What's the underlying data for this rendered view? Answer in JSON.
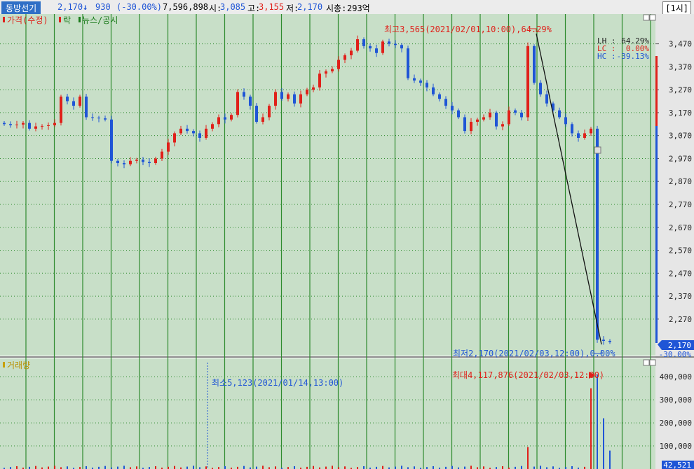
{
  "header": {
    "symbol": "동방선기",
    "price": "2,170",
    "change_arrow": "↓",
    "change": "930",
    "change_pct": "(-30.00%)",
    "volume": "7,596,898",
    "open_label": "시:",
    "open": "3,085",
    "high_label": "고:",
    "high": "3,155",
    "low_label": "저:",
    "low": "2,170",
    "mcap_label": "시총:",
    "mcap": "293억",
    "interval": "[1시]"
  },
  "legend": {
    "price": "가격(수정)",
    "rak": "락",
    "news": "뉴스/공시",
    "volume": "거래량"
  },
  "annotations": {
    "high": "최고3,565(2021/02/01,10:00),64.29%",
    "low": "최저2,170(2021/02/03,12:00),0.00%",
    "vol_max": "최대4,117,876(2021/02/03,12:00)",
    "vol_min": "최소5,123(2021/01/14,13:00)"
  },
  "lh": {
    "lh_label": "LH :",
    "lh": "64.29%",
    "lc_label": "LC :",
    "lc": "0.00%",
    "hc_label": "HC :",
    "hc": "-39.13%"
  },
  "current": {
    "price": "2,170",
    "pct": "-30.00%"
  },
  "colors": {
    "up": "#e0201a",
    "down": "#1f55d6",
    "bg": "#c8dfc8",
    "grid": "#2e8b2e"
  },
  "chart_data": {
    "type": "candlestick",
    "ylim": [
      2120,
      3600
    ],
    "y_ticks": [
      "3,470",
      "3,370",
      "3,270",
      "3,170",
      "3,070",
      "2,970",
      "2,870",
      "2,770",
      "2,670",
      "2,570",
      "2,470",
      "2,370",
      "2,270"
    ],
    "y_tick_values": [
      3470,
      3370,
      3270,
      3170,
      3070,
      2970,
      2870,
      2770,
      2670,
      2570,
      2470,
      2370,
      2270
    ],
    "volume_ylim": [
      0,
      440000
    ],
    "volume_ticks": [
      "400,000",
      "300,000",
      "200,000",
      "100,000"
    ],
    "volume_tick_values": [
      400000,
      300000,
      200000,
      100000
    ],
    "volume_last": "42,521",
    "close": [
      3120,
      3115,
      3118,
      3125,
      3100,
      3110,
      3112,
      3115,
      3125,
      3240,
      3220,
      3200,
      3240,
      3150,
      3148,
      3145,
      3140,
      2960,
      2950,
      2945,
      2960,
      2965,
      2955,
      2950,
      2970,
      3000,
      3040,
      3080,
      3100,
      3090,
      3080,
      3060,
      3100,
      3120,
      3150,
      3140,
      3160,
      3260,
      3240,
      3200,
      3130,
      3150,
      3200,
      3260,
      3230,
      3250,
      3210,
      3250,
      3270,
      3280,
      3340,
      3350,
      3360,
      3400,
      3420,
      3440,
      3490,
      3460,
      3450,
      3430,
      3480,
      3470,
      3465,
      3450,
      3320,
      3310,
      3300,
      3280,
      3250,
      3230,
      3200,
      3180,
      3150,
      3090,
      3130,
      3140,
      3150,
      3170,
      3110,
      3120,
      3180,
      3170,
      3150,
      3460,
      3300,
      3250,
      3210,
      3180,
      3150,
      3120,
      3080,
      3060,
      3080,
      3100,
      2180,
      2175,
      2170
    ]
  }
}
